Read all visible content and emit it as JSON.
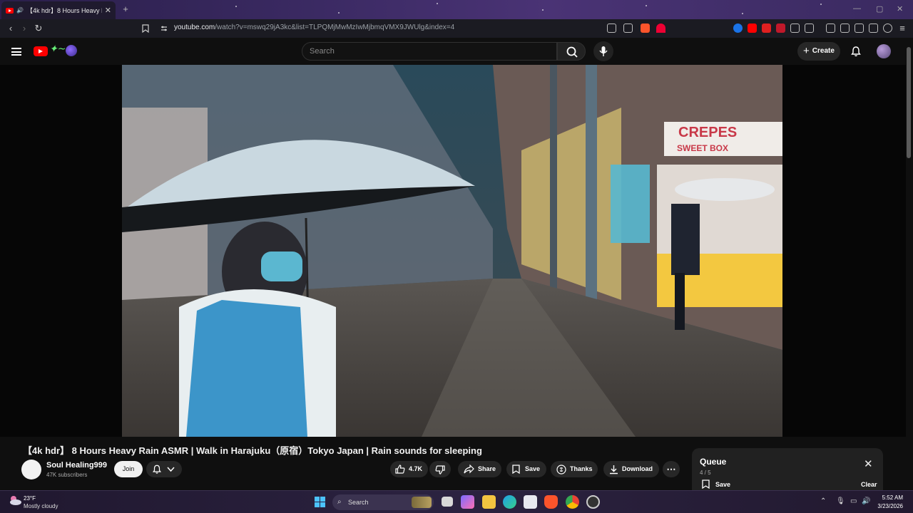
{
  "browser": {
    "tab_title": "【4k hdr】8 Hours Heavy Rain",
    "tab_close": "✕",
    "new_tab": "+",
    "url_host": "youtube.com",
    "url_path": "/watch?v=mswq29jA3kc&list=TLPQMjMwMzIwMjbmqVMX9JWUlg&index=4"
  },
  "masthead": {
    "search_placeholder": "Search",
    "create_label": "Create"
  },
  "video": {
    "title": "【4k hdr】 8 Hours Heavy Rain ASMR | Walk in Harajuku（原宿）Tokyo Japan | Rain sounds for sleeping",
    "shop_sign_line1": "CREPES",
    "shop_sign_line2": "SWEET BOX"
  },
  "channel": {
    "name": "Soul Healing999",
    "subscribers": "47K subscribers",
    "join_label": "Join"
  },
  "actions": {
    "likes": "4.7K",
    "share": "Share",
    "save": "Save",
    "thanks": "Thanks",
    "download": "Download",
    "more": "⋯"
  },
  "queue": {
    "title": "Queue",
    "count": "4 / 5",
    "save": "Save",
    "clear": "Clear",
    "close": "✕"
  },
  "taskbar": {
    "temperature": "23°F",
    "weather": "Mostly cloudy",
    "search": "Search",
    "time": "5:52 AM",
    "date": "3/23/2026"
  },
  "colors": {
    "youtube_red": "#ff0000",
    "page_bg": "#0f0f0f",
    "chip_bg": "#272727"
  },
  "icons": [
    "youtube-logo-icon",
    "search-icon",
    "mic-icon",
    "bell-icon",
    "like-icon",
    "dislike-icon",
    "share-icon",
    "bookmark-icon",
    "thanks-icon",
    "download-icon",
    "close-icon",
    "windows-start-icon"
  ]
}
